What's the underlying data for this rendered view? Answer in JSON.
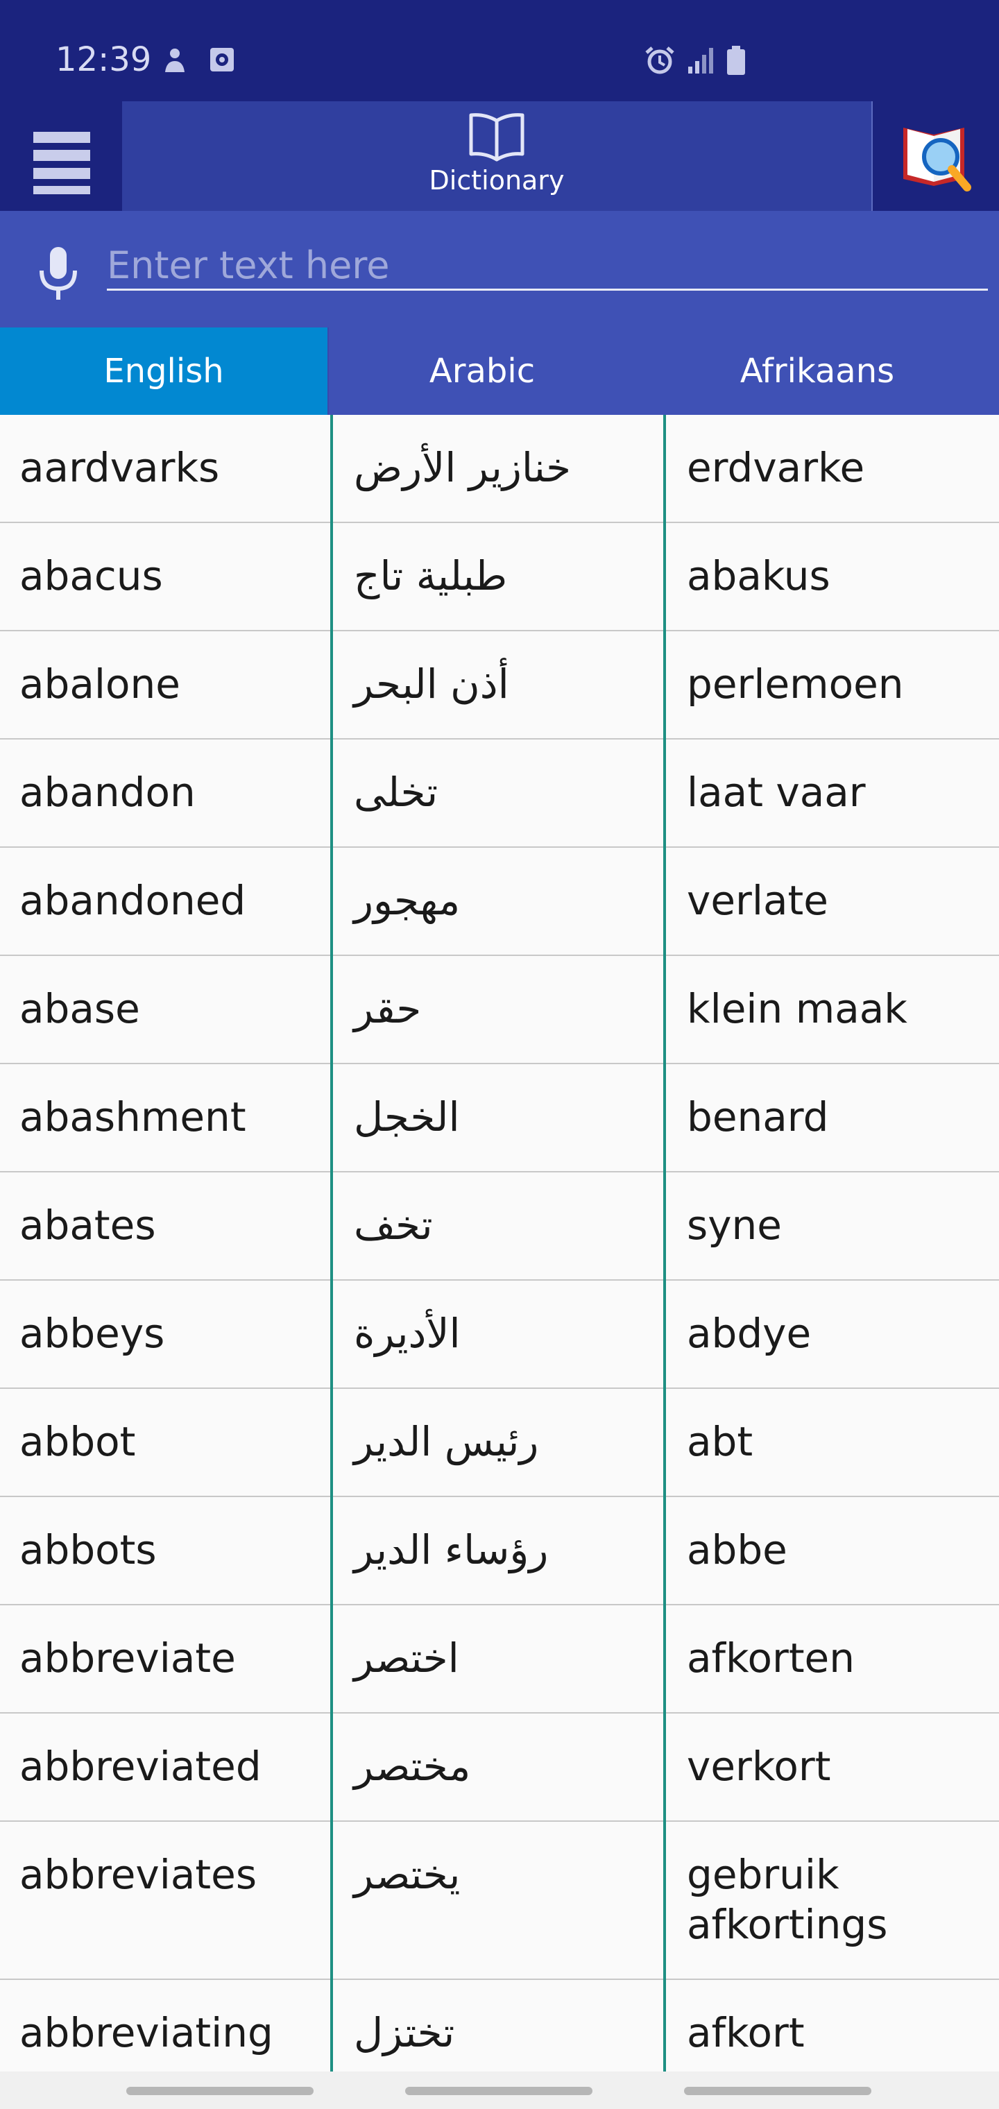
{
  "status": {
    "time": "12:39"
  },
  "toolbar": {
    "title": "Dictionary"
  },
  "search": {
    "placeholder": "Enter text here",
    "value": ""
  },
  "languages": [
    "English",
    "Arabic",
    "Afrikaans"
  ],
  "active_language": "English",
  "rows": [
    [
      "aardvarks",
      "خنازير الأرض",
      "erdvarke"
    ],
    [
      "abacus",
      "طبلية تاج",
      "abakus"
    ],
    [
      "abalone",
      "أذن البحر",
      "perlemoen"
    ],
    [
      "abandon",
      "تخلى",
      "laat vaar"
    ],
    [
      "abandoned",
      "مهجور",
      "verlate"
    ],
    [
      "abase",
      "حقر",
      "klein maak"
    ],
    [
      "abashment",
      "الخجل",
      "benard"
    ],
    [
      "abates",
      "تخف",
      "syne"
    ],
    [
      "abbeys",
      "الأديرة",
      "abdye"
    ],
    [
      "abbot",
      "رئيس الدير",
      "abt"
    ],
    [
      "abbots",
      "رؤساء الدير",
      "abbe"
    ],
    [
      "abbreviate",
      "اختصر",
      "afkorten"
    ],
    [
      "abbreviated",
      "مختصر",
      "verkort"
    ],
    [
      "abbreviates",
      "يختصر",
      "gebruik afkortings"
    ],
    [
      "abbreviating",
      "تختزل",
      "afkort"
    ]
  ],
  "colors": {
    "statusbar": "#1b237e",
    "toolbar_tab": "#303f9f",
    "search_bg": "#3f51b5",
    "active_tab": "#0288d1",
    "divider": "#1e8f83"
  }
}
